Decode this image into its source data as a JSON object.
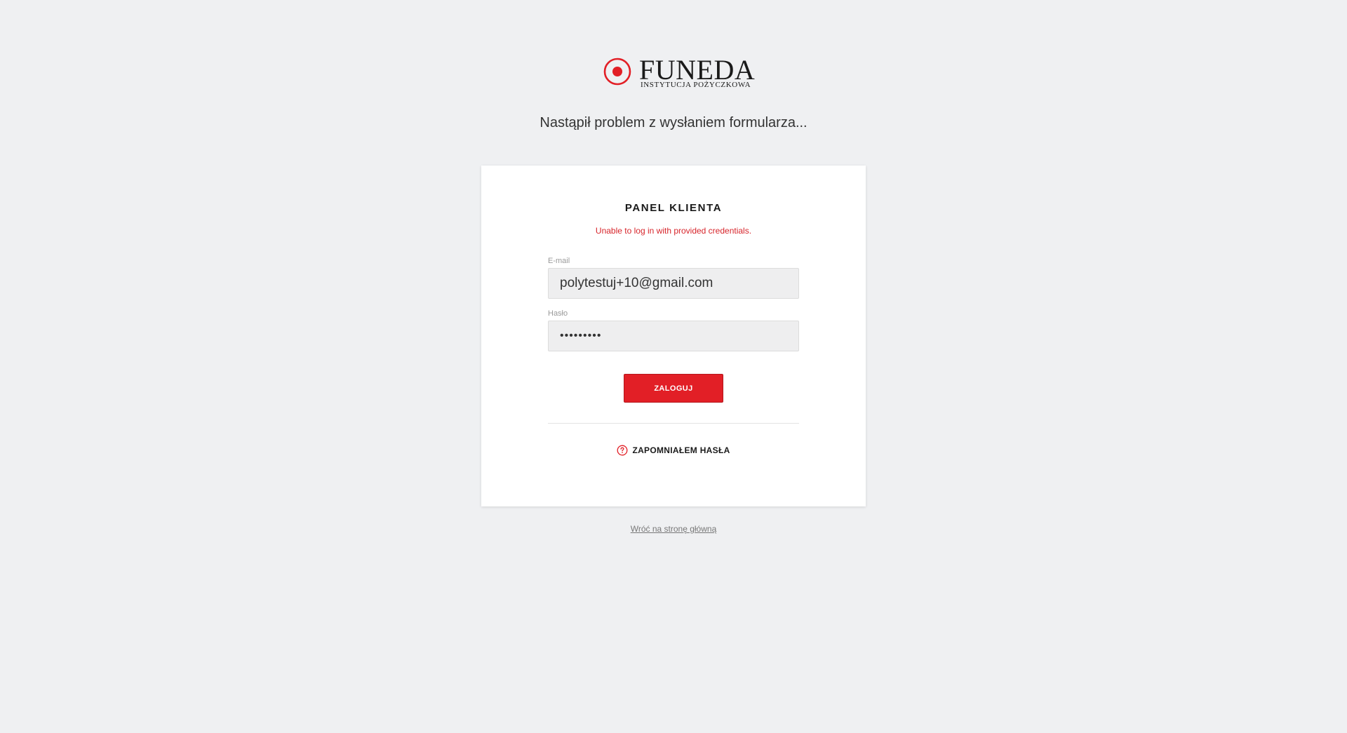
{
  "brand": {
    "name": "FUNEDA",
    "subtitle": "INSTYTUCJA POŻYCZKOWA",
    "accent_color": "#e21f26"
  },
  "notice": "Nastąpił problem z wysłaniem formularza...",
  "panel": {
    "title": "PANEL KLIENTA",
    "error": "Unable to log in with provided credentials.",
    "email": {
      "label": "E-mail",
      "value": "polytestuj+10@gmail.com"
    },
    "password": {
      "label": "Hasło",
      "value": "•••••••••"
    },
    "login_button": "ZALOGUJ",
    "forgot_password": "ZAPOMNIAŁEM HASŁA",
    "forgot_icon": "question-circle-icon"
  },
  "back_link": "Wróć na stronę główną"
}
